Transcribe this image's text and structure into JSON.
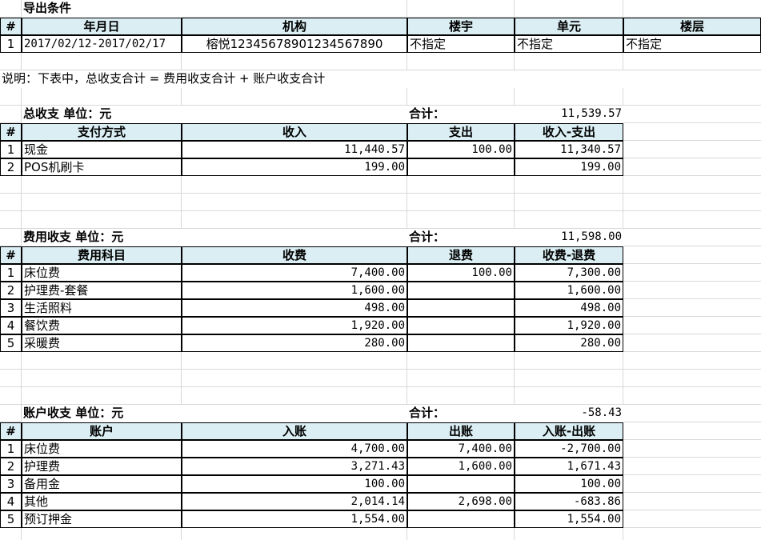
{
  "export_conditions": {
    "title": "导出条件",
    "headers": [
      "#",
      "年月日",
      "机构",
      "楼宇",
      "单元",
      "楼层"
    ],
    "row": [
      "1",
      "2017/02/12-2017/02/17",
      "榕悦12345678901234567890",
      "不指定",
      "不指定",
      "不指定"
    ]
  },
  "note": "说明：下表中，总收支合计 = 费用收支合计 + 账户收支合计",
  "total": {
    "title": "总收支 单位：元",
    "sum_label": "合计：",
    "sum_value": "11,539.57",
    "headers": [
      "#",
      "支付方式",
      "收入",
      "支出",
      "收入-支出"
    ],
    "rows": [
      [
        "1",
        "现金",
        "11,440.57",
        "100.00",
        "11,340.57"
      ],
      [
        "2",
        "POS机刷卡",
        "199.00",
        "",
        "199.00"
      ]
    ]
  },
  "fee": {
    "title": "费用收支 单位：元",
    "sum_label": "合计：",
    "sum_value": "11,598.00",
    "headers": [
      "#",
      "费用科目",
      "收费",
      "退费",
      "收费-退费"
    ],
    "rows": [
      [
        "1",
        "床位费",
        "7,400.00",
        "100.00",
        "7,300.00"
      ],
      [
        "2",
        "护理费-套餐",
        "1,600.00",
        "",
        "1,600.00"
      ],
      [
        "3",
        "生活照料",
        "498.00",
        "",
        "498.00"
      ],
      [
        "4",
        "餐饮费",
        "1,920.00",
        "",
        "1,920.00"
      ],
      [
        "5",
        "采暖费",
        "280.00",
        "",
        "280.00"
      ]
    ]
  },
  "account": {
    "title": "账户收支 单位：元",
    "sum_label": "合计：",
    "sum_value": "-58.43",
    "headers": [
      "#",
      "账户",
      "入账",
      "出账",
      "入账-出账"
    ],
    "rows": [
      [
        "1",
        "床位费",
        "4,700.00",
        "7,400.00",
        "-2,700.00"
      ],
      [
        "2",
        "护理费",
        "3,271.43",
        "1,600.00",
        "1,671.43"
      ],
      [
        "3",
        "备用金",
        "100.00",
        "",
        "100.00"
      ],
      [
        "4",
        "其他",
        "2,014.14",
        "2,698.00",
        "-683.86"
      ],
      [
        "5",
        "预订押金",
        "1,554.00",
        "",
        "1,554.00"
      ]
    ]
  }
}
